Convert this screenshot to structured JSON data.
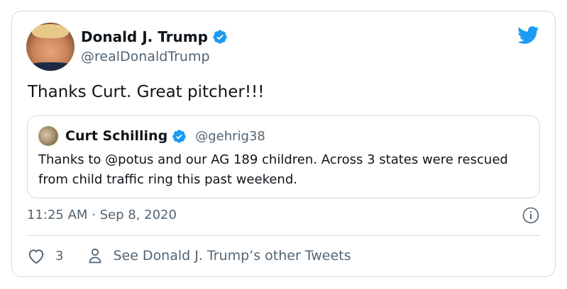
{
  "author": {
    "name": "Donald J. Trump",
    "handle": "@realDonaldTrump"
  },
  "tweet": {
    "text": "Thanks Curt. Great pitcher!!!"
  },
  "quote": {
    "name": "Curt Schilling",
    "handle": "@gehrig38",
    "text": "Thanks to @potus and our AG 189 children. Across 3 states were rescued from child traffic ring this past weekend."
  },
  "meta": {
    "timestamp": "11:25 AM · Sep 8, 2020"
  },
  "actions": {
    "like_count": "3",
    "other_tweets_label": "See Donald J. Trump’s other Tweets"
  },
  "icons": {
    "brand": "twitter-bird-icon",
    "verified": "verified-badge-icon",
    "info": "info-icon",
    "like": "heart-icon",
    "profile": "person-icon"
  },
  "colors": {
    "brand": "#1d9bf0",
    "text": "#0f1419",
    "secondary": "#536471",
    "border": "#cfd9de"
  }
}
